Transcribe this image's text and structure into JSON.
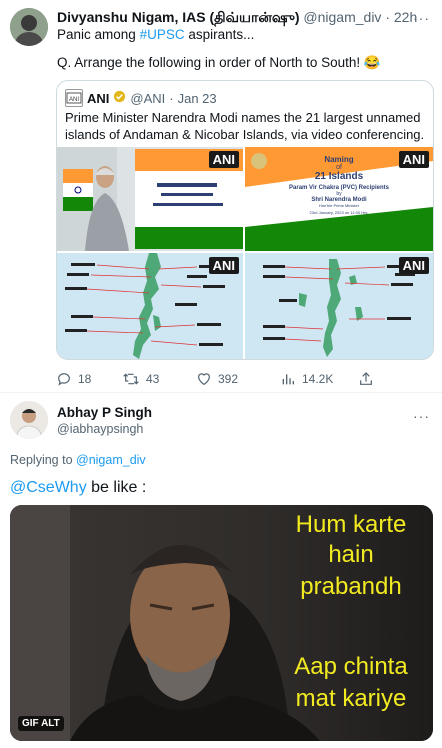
{
  "tweet1": {
    "author_name": "Divyanshu Nigam, IAS (திவ்யான்ஷு)",
    "handle": "@nigam_div",
    "time": "22h",
    "text_line1_pre": "Panic among ",
    "hashtag": "#UPSC",
    "text_line1_post": " aspirants...",
    "text_line2": "Q. Arrange the following in order of North to South! 😂",
    "quote": {
      "author_name": "ANI",
      "handle": "@ANI",
      "date": "Jan 23",
      "text": "Prime Minister Narendra Modi names the 21 largest unnamed islands of Andaman & Nicobar Islands, via video conferencing.",
      "ani_label": "ANI",
      "slide_title_1": "Naming",
      "slide_title_2": "of",
      "slide_title_3": "21 Islands",
      "slide_sub": "Param Vir Chakra (PVC) Recipients",
      "slide_by": "by",
      "slide_name": "Shri Narendra Modi",
      "slide_role": "Hon'ble Prime Minister",
      "slide_date": "23rd January, 2023 on 11:00 Hrs."
    },
    "stats": {
      "replies": "18",
      "retweets": "43",
      "likes": "392",
      "views": "14.2K"
    }
  },
  "tweet2": {
    "author_name": "Abhay P Singh",
    "handle": "@iabhaypsingh",
    "replying_prefix": "Replying to ",
    "replying_handle": "@nigam_div",
    "mention": "@CseWhy",
    "text_post": " be like :",
    "gif": {
      "caption_line1": "Hum karte",
      "caption_line2": "hain",
      "caption_line3": "prabandh",
      "caption_line4": "Aap chinta",
      "caption_line5": "mat kariye",
      "badge": "GIF  ALT"
    }
  },
  "colors": {
    "accent": "#1d9bf0",
    "muted": "#536471",
    "caption": "#f2ea20"
  }
}
